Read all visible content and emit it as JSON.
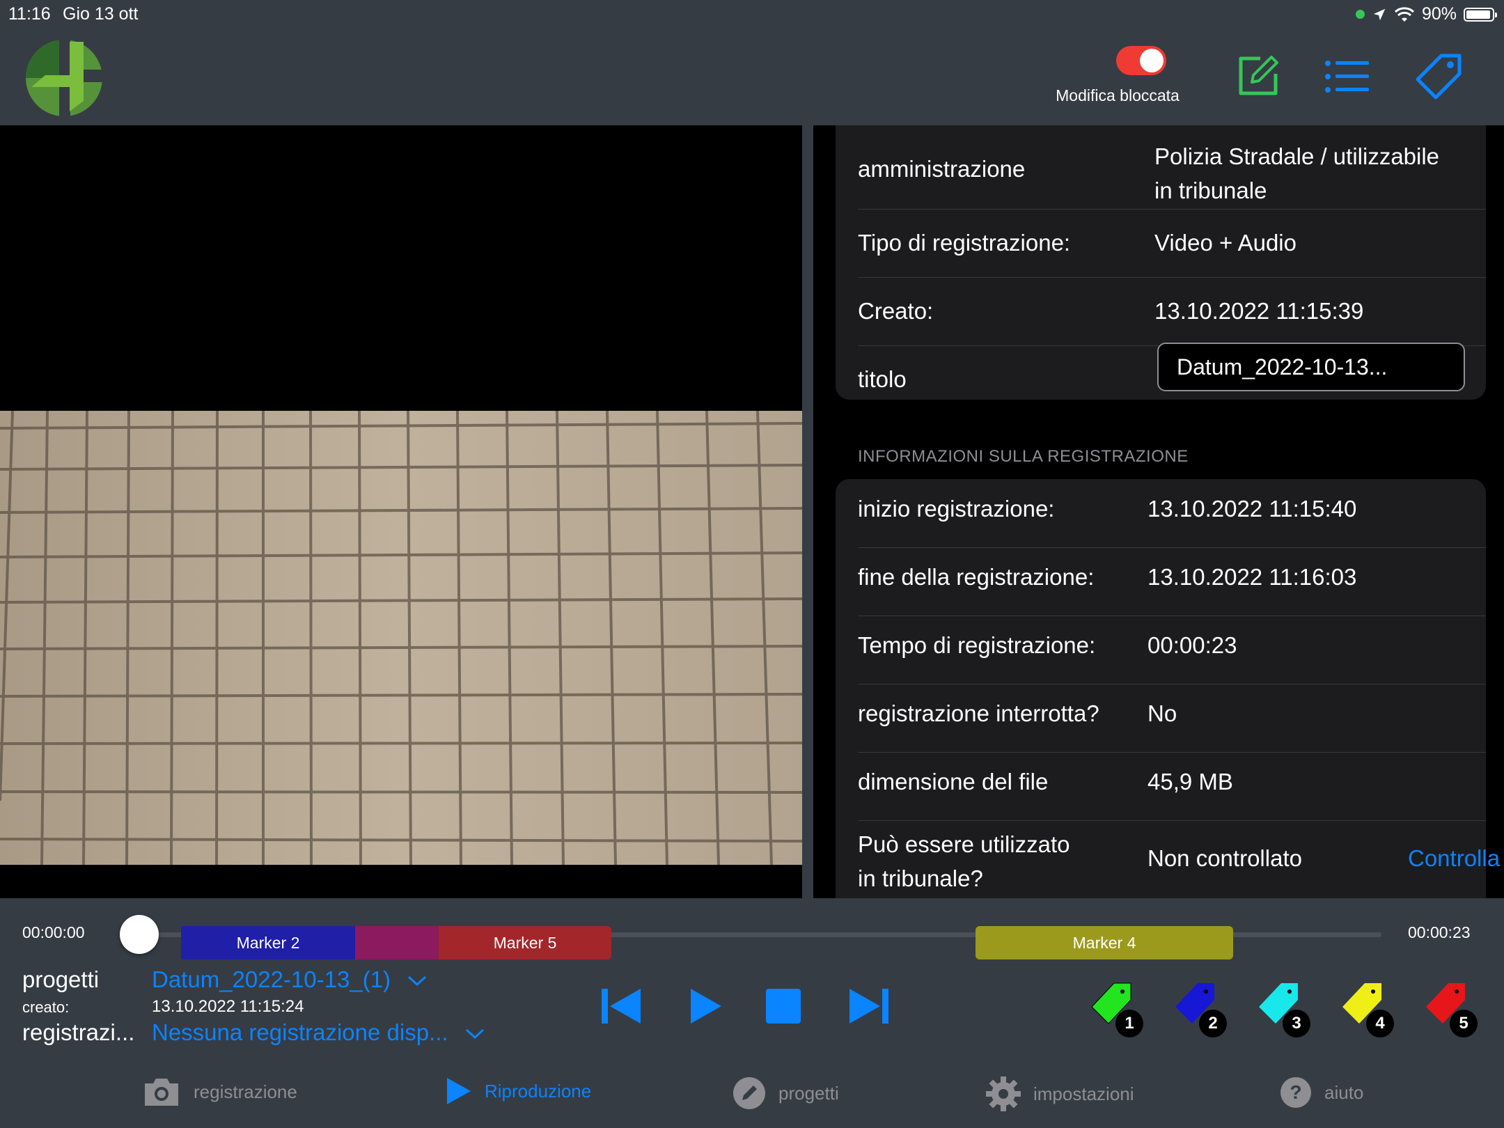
{
  "status_bar": {
    "time": "11:16",
    "date": "Gio 13 ott",
    "battery": "90%"
  },
  "toolbar": {
    "toggle_label": "Modifica bloccata",
    "toggle_on": true,
    "icons": [
      "edit-icon",
      "list-icon",
      "tag-icon"
    ]
  },
  "details": {
    "general_rows": [
      {
        "label": "amministrazione",
        "value_line1": "Polizia Stradale / utilizzabile",
        "value_line2": "in tribunale"
      },
      {
        "label": "Tipo di registrazione:",
        "value": "Video + Audio"
      },
      {
        "label": "Creato:",
        "value": "13.10.2022 11:15:39"
      },
      {
        "label": "titolo",
        "value": "Datum_2022-10-13..."
      }
    ],
    "section_header": "INFORMAZIONI SULLA REGISTRAZIONE",
    "recording_rows": [
      {
        "label": "inizio registrazione:",
        "value": "13.10.2022 11:15:40"
      },
      {
        "label": "fine della registrazione:",
        "value": "13.10.2022 11:16:03"
      },
      {
        "label": "Tempo di registrazione:",
        "value": "00:00:23"
      },
      {
        "label": "registrazione interrotta?",
        "value": "No"
      },
      {
        "label": "dimensione del file",
        "value": "45,9 MB"
      },
      {
        "label_line1": "Può essere utilizzato",
        "label_line2": "in tribunale?",
        "value": "Non controllato",
        "action": "Controlla"
      }
    ]
  },
  "timeline": {
    "start_time": "00:00:00",
    "end_time": "00:00:23",
    "markers": [
      {
        "label": "Marker 2",
        "color": "#1f1fa8"
      },
      {
        "label": "Marker 5",
        "color": "#a3262a"
      },
      {
        "label": "Marker 4",
        "color": "#9b9a1d"
      }
    ]
  },
  "info": {
    "project_label": "progetti",
    "project_value": "Datum_2022-10-13_(1)",
    "created_label": "creato:",
    "created_value": "13.10.2022 11:15:24",
    "recording_label": "registrazi...",
    "recording_value": "Nessuna registrazione disp..."
  },
  "tags": [
    {
      "num": "1",
      "color": "#22e51f"
    },
    {
      "num": "2",
      "color": "#1717d6"
    },
    {
      "num": "3",
      "color": "#18e8ec"
    },
    {
      "num": "4",
      "color": "#f0ee17"
    },
    {
      "num": "5",
      "color": "#e6161a"
    }
  ],
  "tabbar": [
    {
      "label": "registrazione",
      "icon": "camera-icon",
      "active": false
    },
    {
      "label": "Riproduzione",
      "icon": "play-icon",
      "active": true
    },
    {
      "label": "progetti",
      "icon": "pencil-icon",
      "active": false
    },
    {
      "label": "impostazioni",
      "icon": "gear-icon",
      "active": false
    },
    {
      "label": "aiuto",
      "icon": "help-icon",
      "active": false
    }
  ]
}
